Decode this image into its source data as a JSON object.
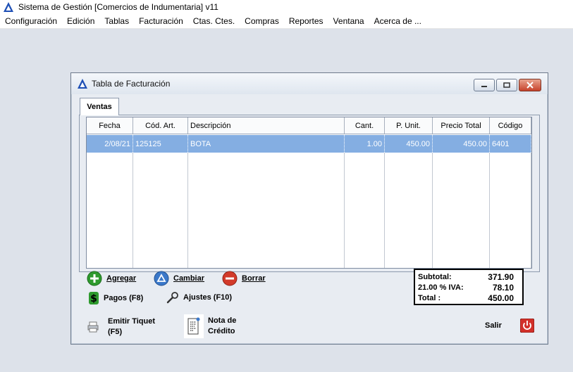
{
  "app": {
    "title": "Sistema de Gestión [Comercios de Indumentaria]  v11"
  },
  "menu": [
    "Configuración",
    "Edición",
    "Tablas",
    "Facturación",
    "Ctas. Ctes.",
    "Compras",
    "Reportes",
    "Ventana",
    "Acerca de ..."
  ],
  "window": {
    "title": "Tabla de Facturación",
    "tab": "Ventas"
  },
  "grid": {
    "columns": [
      "Fecha",
      "Cód. Art.",
      "Descripción",
      "Cant.",
      "P. Unit.",
      "Precio Total",
      "Código"
    ],
    "rows": [
      [
        "2/08/21",
        "125125",
        "BOTA",
        "1.00",
        "450.00",
        "450.00",
        "6401"
      ]
    ]
  },
  "actions": {
    "agregar": "Agregar",
    "cambiar": "Cambiar",
    "borrar": "Borrar",
    "pagos": "Pagos (F8)",
    "ajustes": "Ajustes (F10)"
  },
  "totals": {
    "subtotal_label": "Subtotal:",
    "subtotal_value": "371.90",
    "iva_rate": "21.00",
    "iva_label": "% IVA:",
    "iva_value": "78.10",
    "total_label": "Total :",
    "total_value": "450.00"
  },
  "footer": {
    "emitir_line1": "Emitir Tiquet",
    "emitir_line2": "(F5)",
    "nota_line1": "Nota de",
    "nota_line2": "Crédito",
    "salir": "Salir"
  },
  "colors": {
    "selected_row": "#84aee2",
    "agregar_icon": "#2e9a2e",
    "cambiar_icon": "#3b78c9",
    "borrar_icon": "#d23a2a",
    "salir_icon": "#d2302a"
  }
}
